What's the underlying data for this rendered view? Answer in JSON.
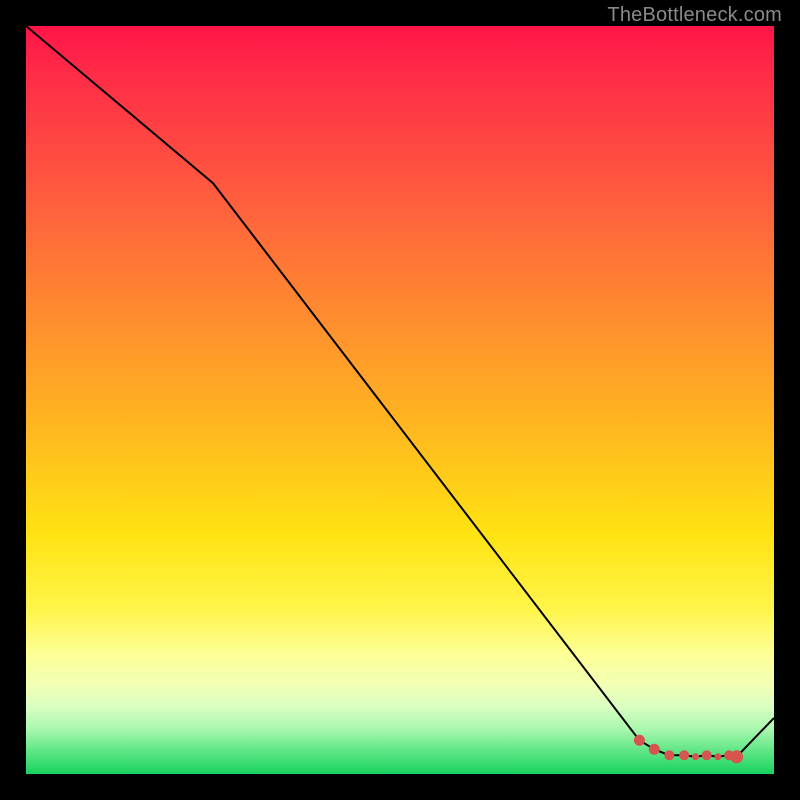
{
  "attribution": "TheBottleneck.com",
  "colors": {
    "accent_dot": "#d6564f",
    "line": "#000000"
  },
  "chart_data": {
    "type": "line",
    "title": "",
    "xlabel": "",
    "ylabel": "",
    "ylim": [
      0,
      100
    ],
    "x": [
      0,
      25,
      82,
      84,
      86,
      88,
      89.5,
      91,
      92.5,
      94,
      95,
      100
    ],
    "values": [
      100,
      79,
      4.5,
      3.3,
      2.5,
      2.5,
      2.3,
      2.5,
      2.3,
      2.5,
      2.3,
      7.5
    ],
    "markers": {
      "x": [
        82,
        84,
        86,
        88,
        89.5,
        91,
        92.5,
        94,
        95
      ],
      "y": [
        4.5,
        3.3,
        2.5,
        2.5,
        2.3,
        2.5,
        2.3,
        2.5,
        2.3
      ],
      "r": [
        5.5,
        5.5,
        5,
        5,
        3.5,
        5,
        3.5,
        5,
        6.5
      ]
    }
  }
}
